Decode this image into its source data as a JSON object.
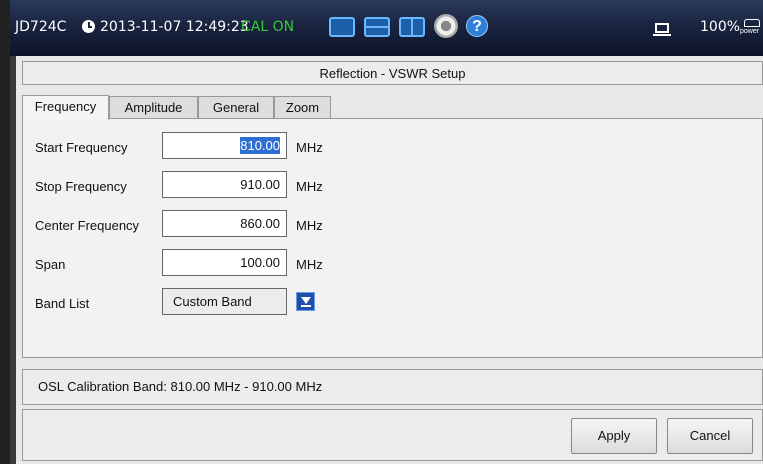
{
  "status_bar": {
    "model": "JD724C",
    "datetime": "2013-11-07 12:49:23",
    "cal_status": "CAL ON",
    "cal_color": "#33cc33",
    "battery": "100%",
    "power_label": "power"
  },
  "dialog": {
    "title": "Reflection - VSWR Setup",
    "tabs": [
      {
        "label": "Frequency",
        "active": true
      },
      {
        "label": "Amplitude",
        "active": false
      },
      {
        "label": "General",
        "active": false
      },
      {
        "label": "Zoom",
        "active": false
      }
    ],
    "fields": {
      "start": {
        "label": "Start Frequency",
        "value": "810.00",
        "unit": "MHz"
      },
      "stop": {
        "label": "Stop Frequency",
        "value": "910.00",
        "unit": "MHz"
      },
      "center": {
        "label": "Center Frequency",
        "value": "860.00",
        "unit": "MHz"
      },
      "span": {
        "label": "Span",
        "value": "100.00",
        "unit": "MHz"
      }
    },
    "band_list": {
      "label": "Band List",
      "value": "Custom Band"
    },
    "info": "OSL Calibration Band: 810.00 MHz - 910.00 MHz",
    "buttons": {
      "apply": "Apply",
      "cancel": "Cancel"
    }
  }
}
